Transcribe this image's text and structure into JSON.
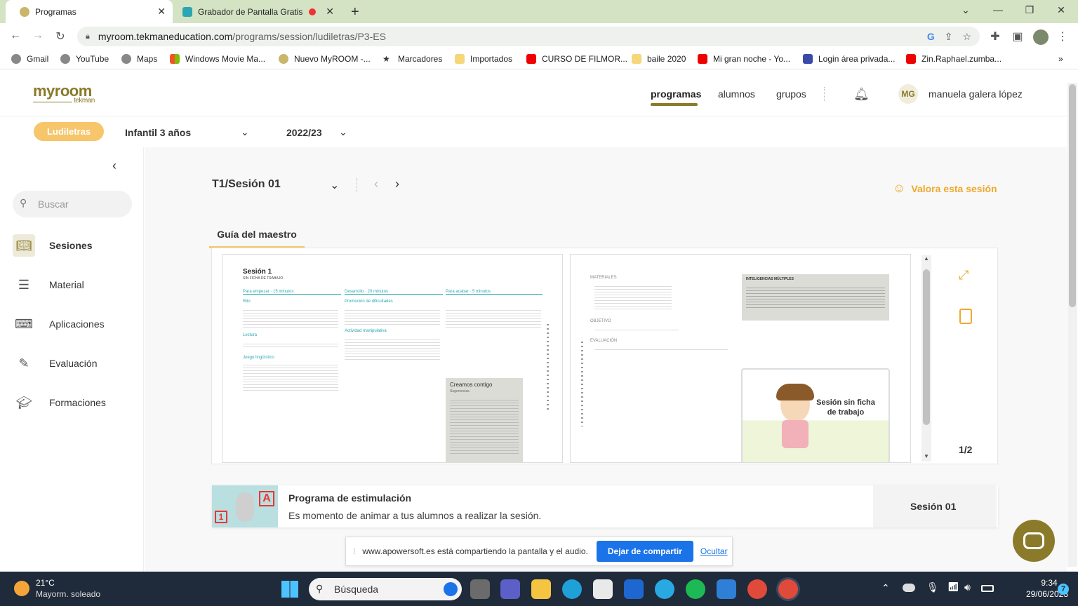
{
  "browser": {
    "tabs": [
      {
        "title": "Programas",
        "active": true
      },
      {
        "title": "Grabador de Pantalla Gratis",
        "active": false
      }
    ],
    "address": {
      "host": "myroom.tekmaneducation.com",
      "path": "/programs/session/ludiletras/P3-ES"
    },
    "bookmarks": [
      "Gmail",
      "YouTube",
      "Maps",
      "Windows Movie Ma...",
      "Nuevo MyROOM -...",
      "Marcadores",
      "Importados",
      "CURSO DE FILMOR...",
      "baile 2020",
      "Mi gran noche - Yo...",
      "Login área privada...",
      "Zin.Raphael.zumba..."
    ],
    "bookmark_more": "»"
  },
  "app": {
    "logo": "myroom",
    "logo_sub": "tekman",
    "nav": {
      "programas": "programas",
      "alumnos": "alumnos",
      "grupos": "grupos"
    },
    "user": {
      "initials": "MG",
      "name": "manuela galera lópez"
    },
    "program_pill": "Ludiletras",
    "level": "Infantil 3 años",
    "year": "2022/23"
  },
  "sidebar": {
    "search_placeholder": "Buscar",
    "items": [
      {
        "label": "Sesiones",
        "icon": "book-icon"
      },
      {
        "label": "Material",
        "icon": "layers-icon"
      },
      {
        "label": "Aplicaciones",
        "icon": "laptop-icon"
      },
      {
        "label": "Evaluación",
        "icon": "evaluation-icon"
      },
      {
        "label": "Formaciones",
        "icon": "graduation-cap-icon"
      }
    ]
  },
  "session": {
    "title": "T1/Sesión 01",
    "rate_label": "Valora esta sesión",
    "tab": "Guía del maestro",
    "page_counter": "1/2"
  },
  "document": {
    "left": {
      "heading": "Sesión 1",
      "subheading": "SIN FICHA DE TRABAJO",
      "col1_head": "Para empezar · 15 minutos",
      "col2_head": "Desarrollo · 20 minutos",
      "col3_head": "Para acabar · 5 minutos",
      "section_a": "Rito",
      "section_b": "Lectura",
      "section_c": "Juego lingüístico",
      "section_d": "Promoción de dificultades",
      "section_e": "Actividad manipulativa",
      "box_title": "Creamos contigo",
      "box_sub": "Sugerencias"
    },
    "right": {
      "materials_head": "MATERIALES",
      "objective_head": "OBJETIVO",
      "evaluation_head": "EVALUACIÓN",
      "intelligences_head": "INTELIGENCIAS MÚLTIPLES",
      "card_text": "Sesión sin ficha de trabajo"
    }
  },
  "banner": {
    "title": "Programa de estimulación",
    "text": "Es momento de animar a tus alumnos a realizar la sesión.",
    "session": "Sesión 01",
    "badge_a": "A",
    "badge_1": "1"
  },
  "sharebar": {
    "text": "www.apowersoft.es está compartiendo la pantalla y el audio.",
    "stop": "Dejar de compartir",
    "hide": "Ocultar"
  },
  "taskbar": {
    "temp": "21°C",
    "weather": "Mayorm. soleado",
    "search": "Búsqueda",
    "time": "9:34",
    "date": "29/06/2023",
    "badge": "7"
  },
  "colors": {
    "accent": "#8a7a2a",
    "pill": "#f7c56a",
    "rate": "#f0a82a",
    "share_button": "#1a73e8",
    "tabstrip": "#d3e3c4"
  }
}
